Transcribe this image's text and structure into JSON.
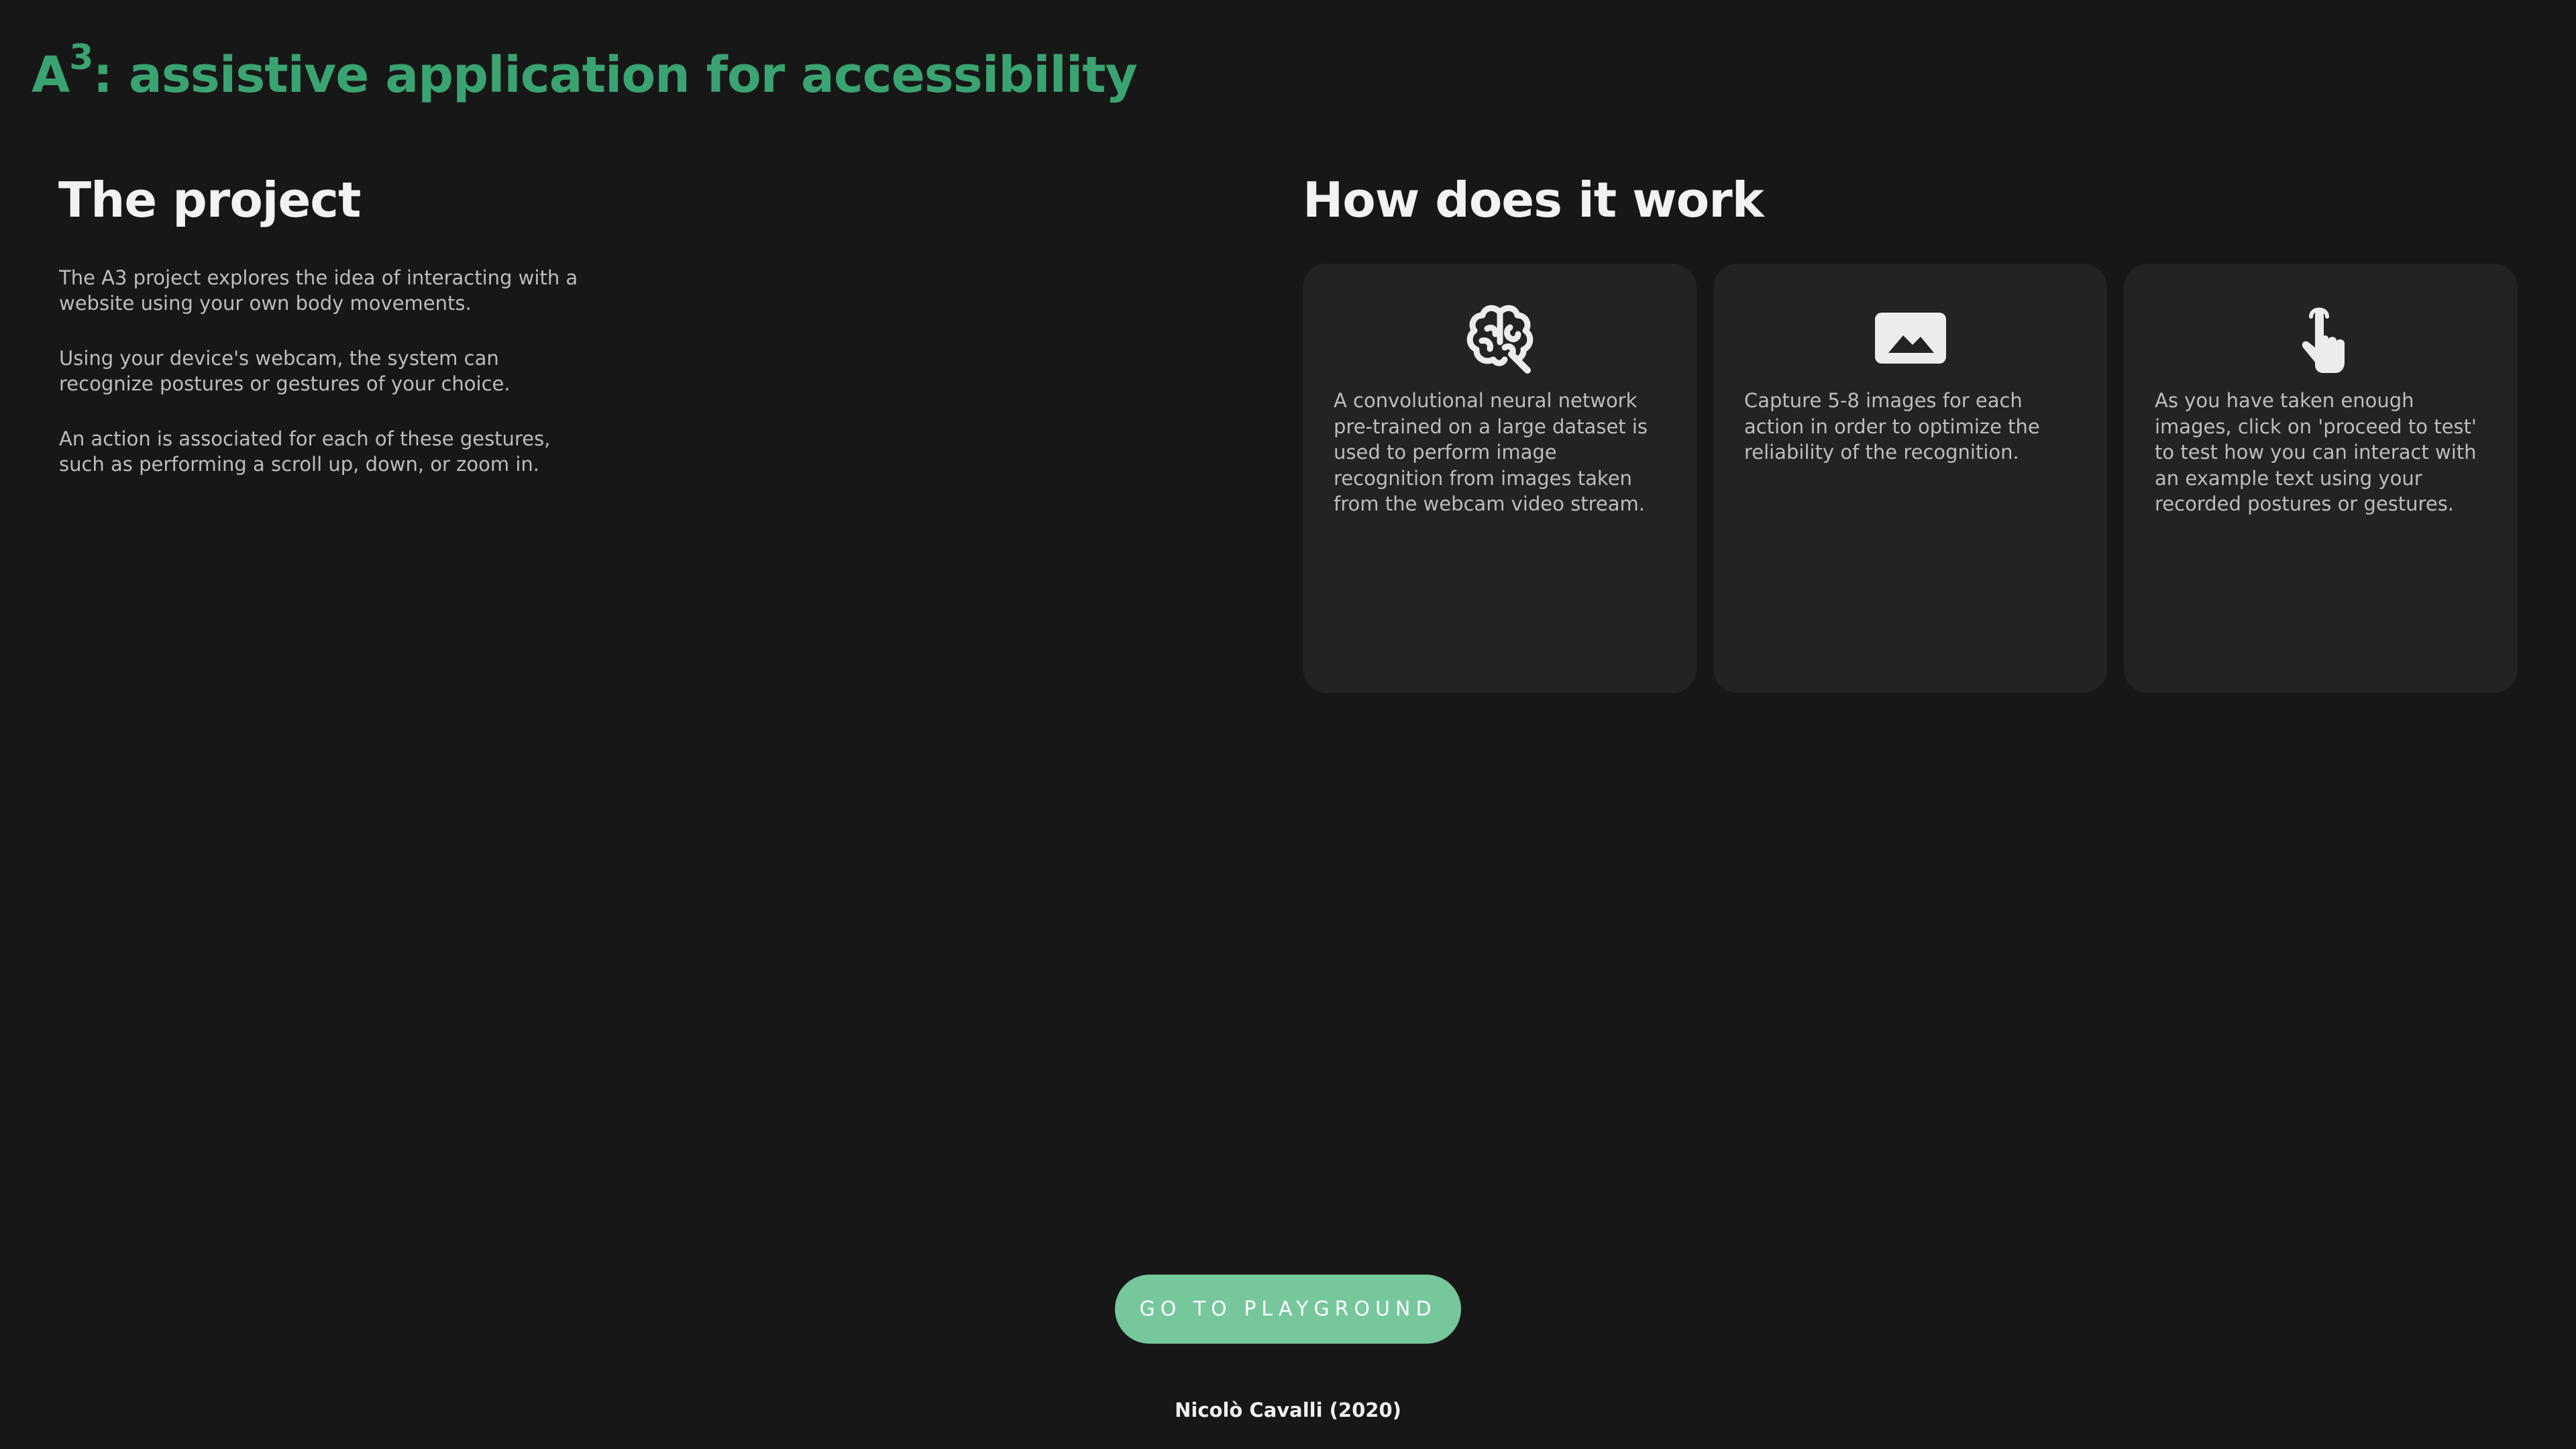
{
  "header": {
    "title_prefix": "A",
    "title_superscript": "3",
    "title_rest": ": assistive application for accessibility"
  },
  "project": {
    "title": "The project",
    "paragraphs": [
      "The A3 project explores the idea of interacting with a website using your own body movements.",
      "Using your device's webcam, the system can recognize postures or gestures of your choice.",
      "An action is associated for each of these gestures, such as performing a scroll up, down, or zoom in."
    ]
  },
  "how": {
    "title": "How does it work",
    "cards": [
      {
        "icon": "brain-icon",
        "text": "A convolutional neural network pre-trained on a large dataset is used to perform image recognition from images taken from the webcam video stream."
      },
      {
        "icon": "image-icon",
        "text": "Capture 5-8 images for each action in order to optimize the reliability of the recognition."
      },
      {
        "icon": "pointer-hand-icon",
        "text": "As you have taken enough images, click on 'proceed to test' to test how you can interact with an example text using your recorded postures or gestures."
      }
    ]
  },
  "cta": {
    "label": "GO TO PLAYGROUND"
  },
  "footer": {
    "credit": "Nicolò Cavalli (2020)"
  },
  "colors": {
    "background": "#181718",
    "accent": "#3aa372",
    "button": "#76c79b",
    "card": "#232323"
  }
}
